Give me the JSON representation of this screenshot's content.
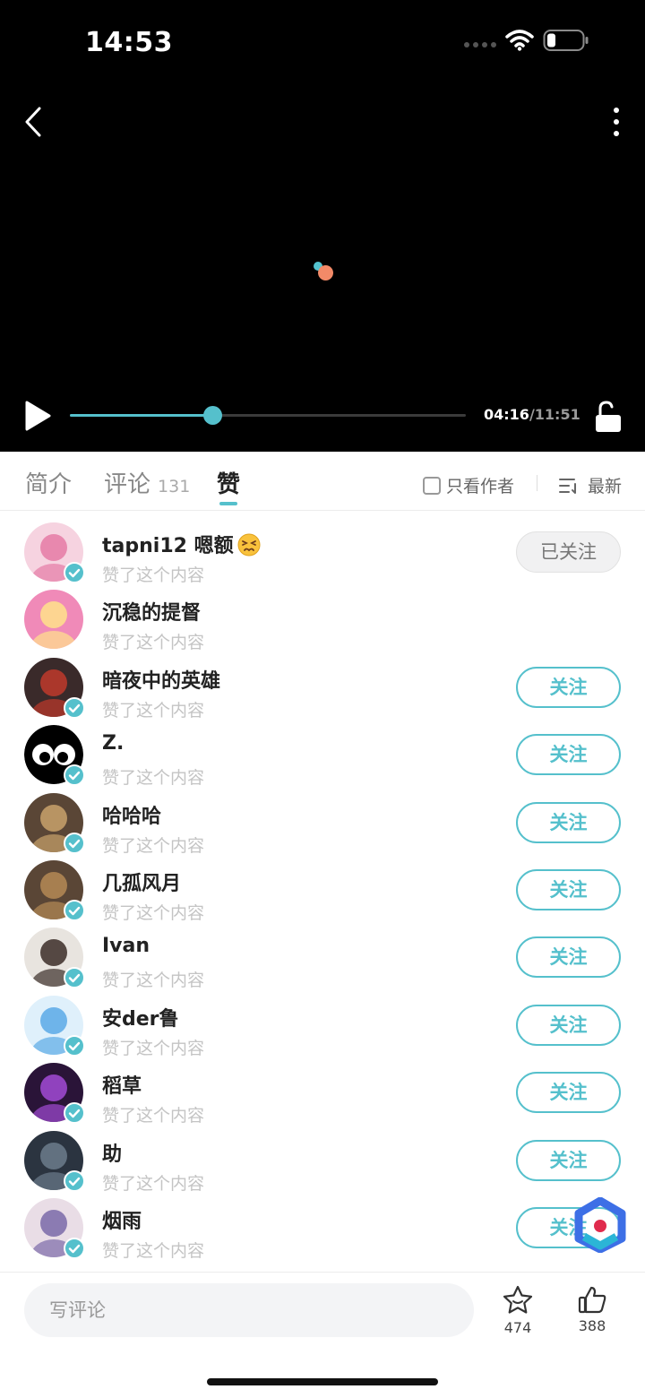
{
  "status": {
    "time": "14:53",
    "battery_level": 0.2
  },
  "player": {
    "current_time": "04:16",
    "total_time": "/11:51",
    "progress": 0.36,
    "accent": "#55c0cc"
  },
  "tabs": {
    "intro": "简介",
    "comments": "评论",
    "comments_count": "131",
    "likes": "赞",
    "only_author": "只看作者",
    "sort": "最新"
  },
  "likers": [
    {
      "name": "tapni12 嗯额",
      "has_emoji": true,
      "sub": "赞了这个内容",
      "button": "已关注",
      "followed": true,
      "verified": true
    },
    {
      "name": "沉稳的提督",
      "sub": "赞了这个内容",
      "button": "",
      "followed": false,
      "verified": false
    },
    {
      "name": "暗夜中的英雄",
      "sub": "赞了这个内容",
      "button": "关注",
      "followed": false,
      "verified": true
    },
    {
      "name": "Z.",
      "sub": "赞了这个内容",
      "button": "关注",
      "followed": false,
      "verified": true
    },
    {
      "name": "哈哈哈",
      "sub": "赞了这个内容",
      "button": "关注",
      "followed": false,
      "verified": true
    },
    {
      "name": "几孤风月",
      "sub": "赞了这个内容",
      "button": "关注",
      "followed": false,
      "verified": true
    },
    {
      "name": "Ivan",
      "sub": "赞了这个内容",
      "button": "关注",
      "followed": false,
      "verified": true
    },
    {
      "name": "安der鲁",
      "sub": "赞了这个内容",
      "button": "关注",
      "followed": false,
      "verified": true
    },
    {
      "name": "稻草",
      "sub": "赞了这个内容",
      "button": "关注",
      "followed": false,
      "verified": true
    },
    {
      "name": "助",
      "sub": "赞了这个内容",
      "button": "关注",
      "followed": false,
      "verified": true
    },
    {
      "name": "烟雨",
      "sub": "赞了这个内容",
      "button": "关注",
      "followed": false,
      "verified": true
    }
  ],
  "bottom": {
    "comment_placeholder": "写评论",
    "favorites_count": "474",
    "likes_count": "388"
  }
}
